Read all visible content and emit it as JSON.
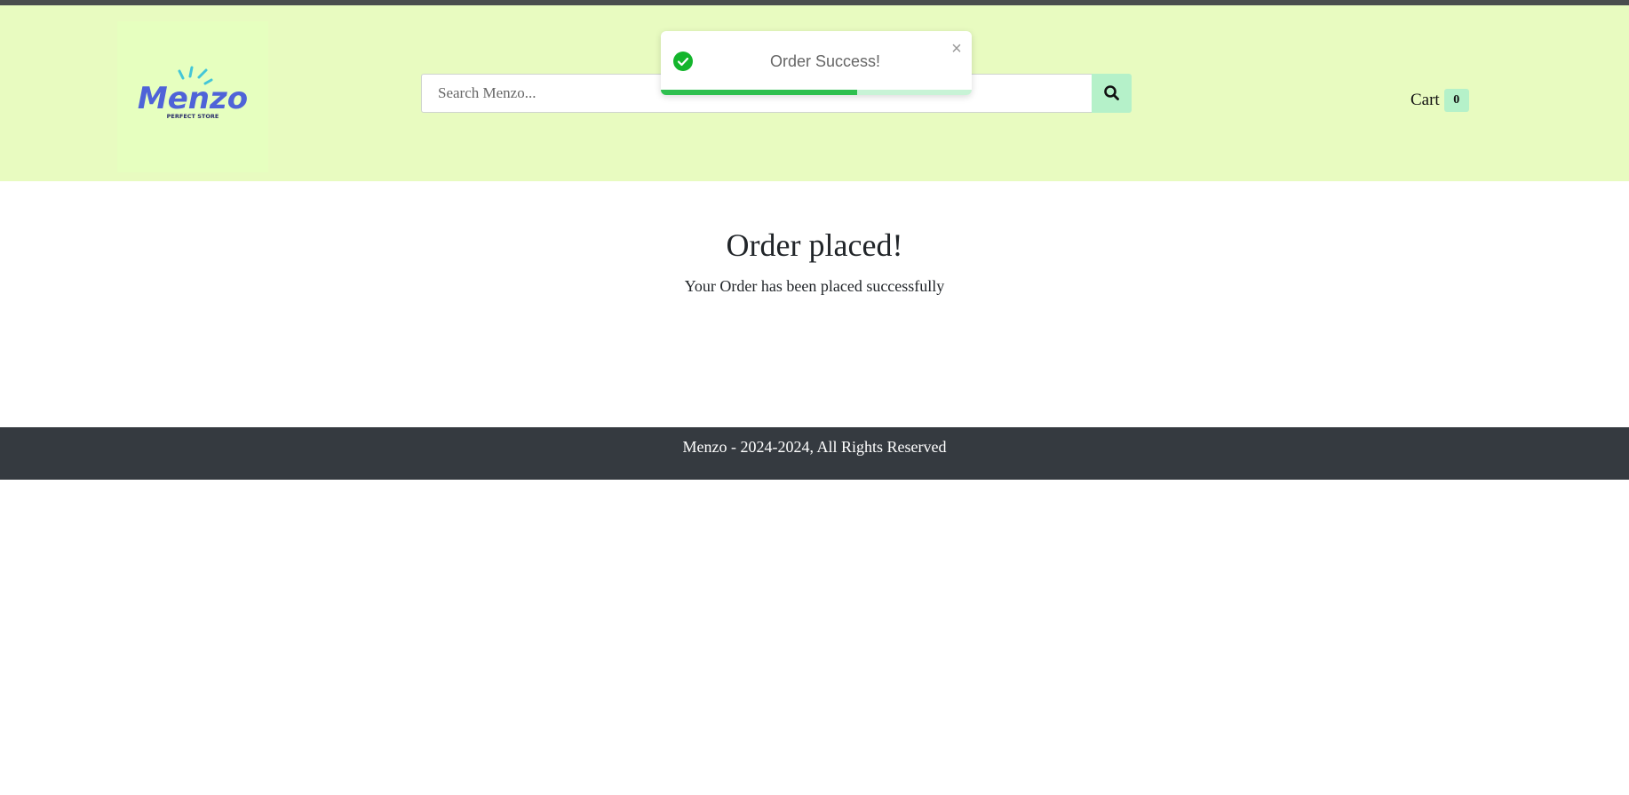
{
  "header": {
    "logo": {
      "brand": "Menzo",
      "tagline": "PERFECT STORE",
      "icon": "sun-rays-logo-icon"
    },
    "search": {
      "placeholder": "Search Menzo...",
      "value": "",
      "button_icon": "search-icon"
    },
    "cart": {
      "label": "Cart",
      "count": "0"
    }
  },
  "toast": {
    "message": "Order Success!",
    "status_icon": "check-circle-icon",
    "close_icon": "close-icon",
    "close_glyph": "×",
    "progress": 0.63
  },
  "main": {
    "title": "Order placed!",
    "subtitle": "Your Order has been placed successfully"
  },
  "footer": {
    "text": "Menzo - 2024-2024, All Rights Reserved"
  },
  "colors": {
    "header_bg": "#e8fbc0",
    "accent": "#b5f1c9",
    "success": "#2fc04f",
    "footer_bg": "#353a40",
    "logo_blue": "#4f63d8",
    "logo_cyan": "#43c6d8"
  }
}
